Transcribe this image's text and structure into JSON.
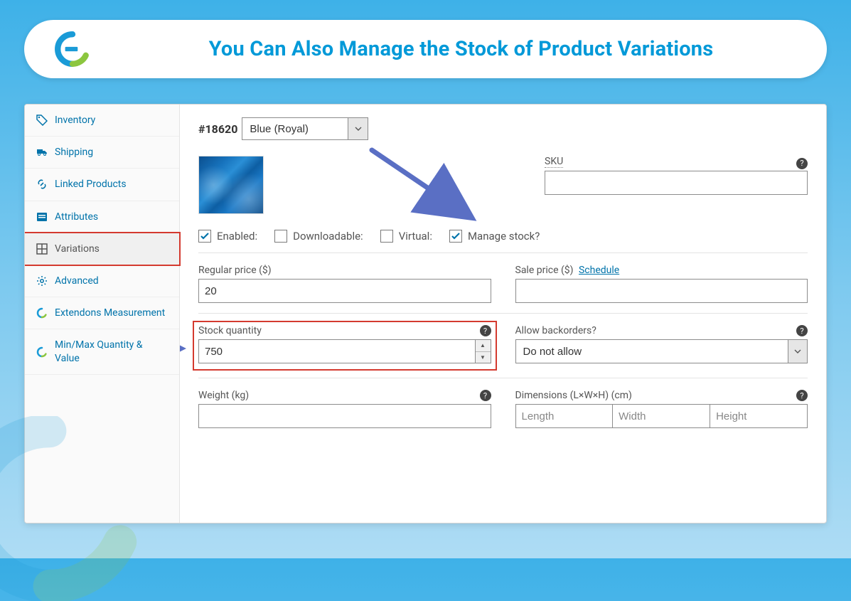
{
  "header": {
    "title": "You Can Also Manage the Stock of Product Variations"
  },
  "sidebar": {
    "items": [
      {
        "label": "Inventory"
      },
      {
        "label": "Shipping"
      },
      {
        "label": "Linked Products"
      },
      {
        "label": "Attributes"
      },
      {
        "label": "Variations"
      },
      {
        "label": "Advanced"
      },
      {
        "label": "Extendons Measurement"
      },
      {
        "label": "Min/Max Quantity & Value"
      }
    ]
  },
  "variation": {
    "id_label": "#18620",
    "color_selected": "Blue (Royal)",
    "sku_label": "SKU",
    "sku_value": "",
    "checks": {
      "enabled": "Enabled:",
      "downloadable": "Downloadable:",
      "virtual": "Virtual:",
      "manage_stock": "Manage stock?"
    },
    "check_state": {
      "enabled": true,
      "downloadable": false,
      "virtual": false,
      "manage_stock": true
    },
    "regular_price_label": "Regular price ($)",
    "regular_price_value": "20",
    "sale_price_label": "Sale price ($)",
    "schedule_text": "Schedule",
    "sale_price_value": "",
    "stock_qty_label": "Stock quantity",
    "stock_qty_value": "750",
    "backorders_label": "Allow backorders?",
    "backorders_value": "Do not allow",
    "weight_label": "Weight (kg)",
    "weight_value": "",
    "dimensions_label": "Dimensions (L×W×H) (cm)",
    "dim_placeholders": {
      "l": "Length",
      "w": "Width",
      "h": "Height"
    }
  }
}
